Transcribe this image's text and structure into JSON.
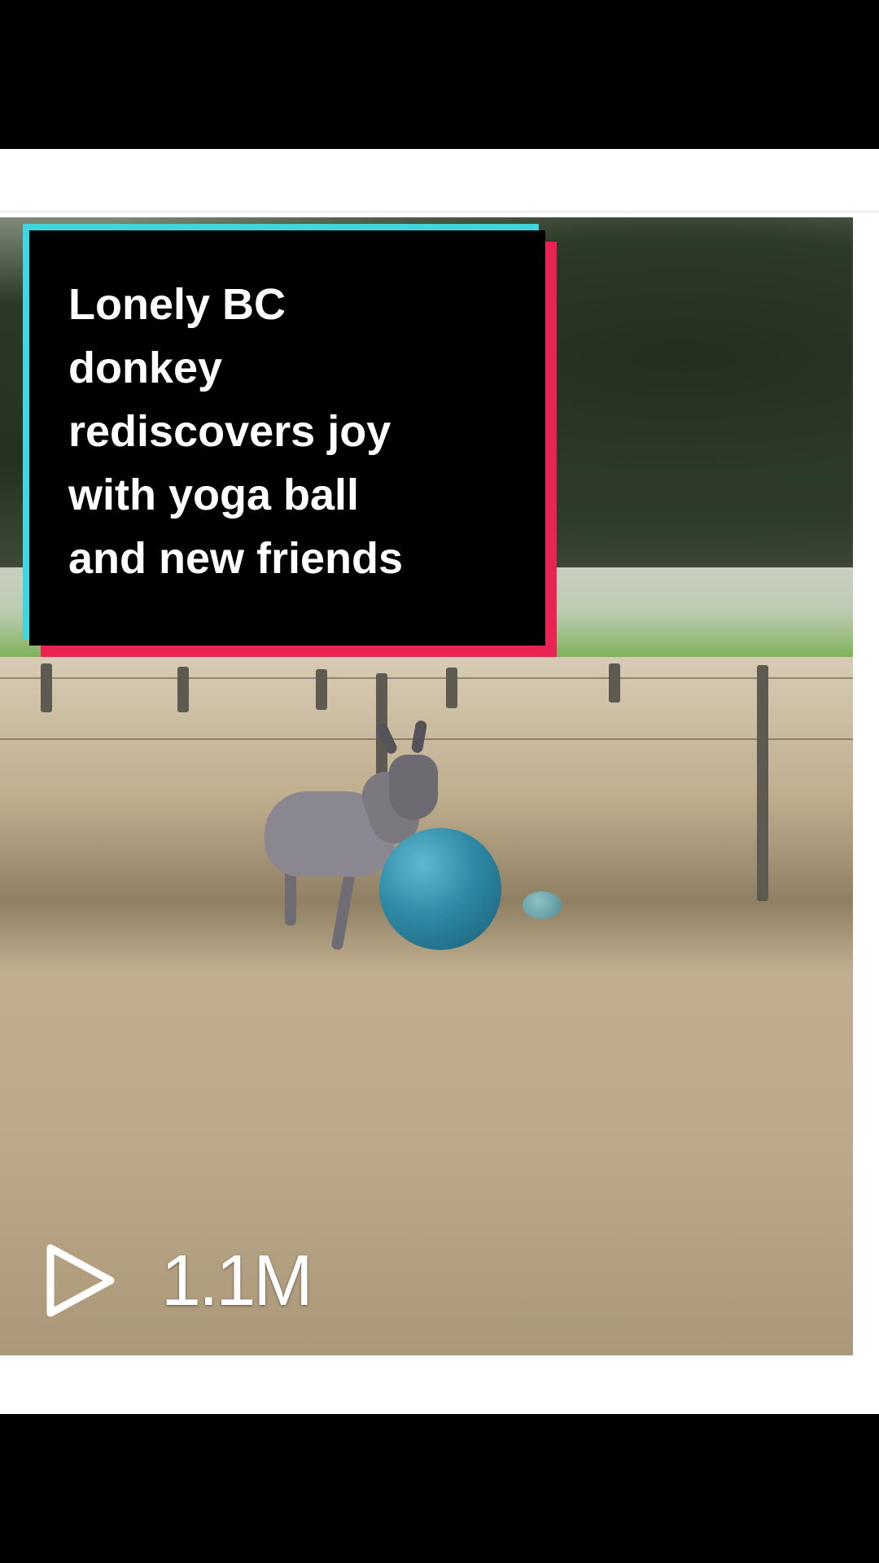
{
  "video": {
    "title": "Lonely BC\ndonkey\nrediscovers joy\nwith yoga ball\nand new friends",
    "views": "1.1M",
    "play_icon": "play-icon"
  },
  "colors": {
    "title_background": "#000000",
    "title_text": "#ffffff",
    "accent_cyan": "#3fd6e2",
    "accent_red": "#ea2452"
  }
}
